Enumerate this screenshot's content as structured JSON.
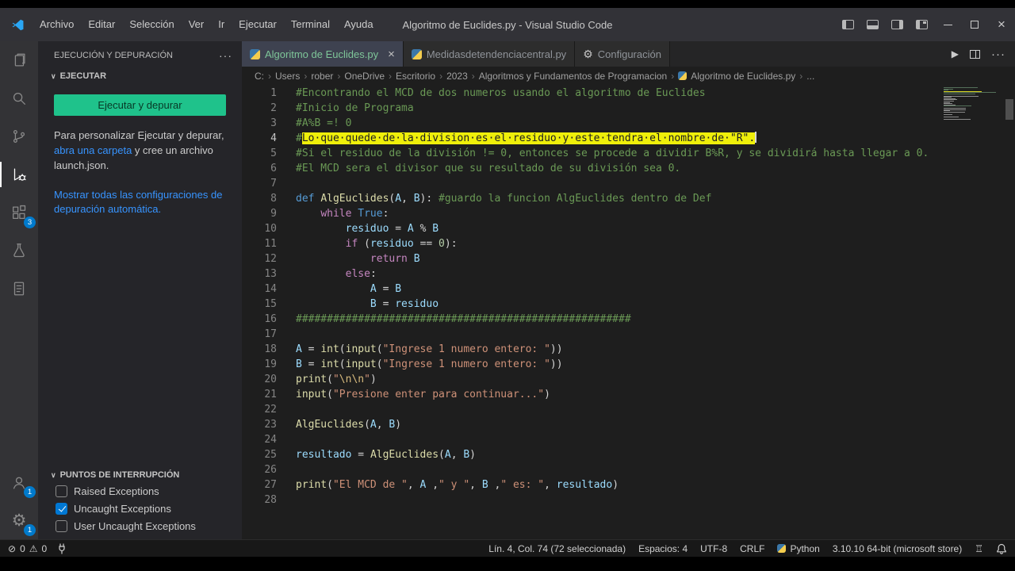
{
  "window": {
    "title": "Algoritmo de Euclides.py - Visual Studio Code"
  },
  "menu": [
    "Archivo",
    "Editar",
    "Selección",
    "Ver",
    "Ir",
    "Ejecutar",
    "Terminal",
    "Ayuda"
  ],
  "colors": {
    "link_accent": "#3794ff",
    "run_button_green": "#1fc28b",
    "selection_highlight": "#efef0a",
    "active_tab_label_green": "#7ec699",
    "badge_blue": "#007acc"
  },
  "tabs": [
    {
      "label": "Algoritmo de Euclides.py",
      "icon": "python",
      "active": true
    },
    {
      "label": "Medidasdetendenciacentral.py",
      "icon": "python",
      "active": false
    },
    {
      "label": "Configuración",
      "icon": "gear",
      "active": false
    }
  ],
  "editor_actions": {
    "run": "▶",
    "more": "···"
  },
  "breadcrumbs": {
    "items": [
      "C:",
      "Users",
      "rober",
      "OneDrive",
      "Escritorio",
      "2023",
      "Algoritmos y Fundamentos de Programacion"
    ],
    "file": "Algoritmo de Euclides.py",
    "more": "..."
  },
  "sidebar": {
    "title": "EJECUCIÓN Y DEPURACIÓN",
    "more": "···",
    "run_section": "EJECUTAR",
    "run_button": "Ejecutar y depurar",
    "hint_before": "Para personalizar Ejecutar y depurar, ",
    "hint_link": "abra una carpeta",
    "hint_after": " y cree un archivo launch.json.",
    "auto_link": "Mostrar todas las configuraciones de depuración automática.",
    "breakpoints_title": "PUNTOS DE INTERRUPCIÓN",
    "breakpoints": [
      {
        "label": "Raised Exceptions",
        "checked": false
      },
      {
        "label": "Uncaught Exceptions",
        "checked": true
      },
      {
        "label": "User Uncaught Exceptions",
        "checked": false
      }
    ]
  },
  "activity_badges": {
    "extensions": "3",
    "account": "1",
    "settings": "1"
  },
  "editor": {
    "active_line": 4,
    "lines": [
      {
        "n": 1,
        "segs": [
          [
            "c",
            "#Encontrando el MCD de dos numeros usando el algoritmo de Euclides"
          ]
        ]
      },
      {
        "n": 2,
        "segs": [
          [
            "c",
            "#Inicio de Programa"
          ]
        ]
      },
      {
        "n": 3,
        "segs": [
          [
            "c",
            "#A%B =! 0"
          ]
        ]
      },
      {
        "n": 4,
        "segs": [
          [
            "c",
            "#"
          ],
          [
            "sel",
            "Lo·que·quede·de·la·division·es·el·residuo·y·este·tendra·el·nombre·de·\"R\"."
          ]
        ]
      },
      {
        "n": 5,
        "segs": [
          [
            "c",
            "#Si el residuo de la división != 0, entonces se procede a dividir B%R, y se dividirá hasta llegar a 0."
          ]
        ]
      },
      {
        "n": 6,
        "segs": [
          [
            "c",
            "#El MCD sera el divisor que su resultado de su división sea 0."
          ]
        ]
      },
      {
        "n": 7,
        "segs": []
      },
      {
        "n": 8,
        "segs": [
          [
            "k",
            "def "
          ],
          [
            "f",
            "AlgEuclides"
          ],
          [
            "t",
            "("
          ],
          [
            "v",
            "A"
          ],
          [
            "t",
            ", "
          ],
          [
            "v",
            "B"
          ],
          [
            "t",
            "): "
          ],
          [
            "c",
            "#guardo la funcion AlgEuclides dentro de Def"
          ]
        ]
      },
      {
        "n": 9,
        "segs": [
          [
            "t",
            "    "
          ],
          [
            "p",
            "while"
          ],
          [
            "t",
            " "
          ],
          [
            "k",
            "True"
          ],
          [
            "t",
            ":"
          ]
        ]
      },
      {
        "n": 10,
        "segs": [
          [
            "t",
            "        "
          ],
          [
            "v",
            "residuo"
          ],
          [
            "t",
            " "
          ],
          [
            "o",
            "="
          ],
          [
            "t",
            " "
          ],
          [
            "v",
            "A"
          ],
          [
            "t",
            " "
          ],
          [
            "o",
            "%"
          ],
          [
            "t",
            " "
          ],
          [
            "v",
            "B"
          ]
        ]
      },
      {
        "n": 11,
        "segs": [
          [
            "t",
            "        "
          ],
          [
            "p",
            "if"
          ],
          [
            "t",
            " ("
          ],
          [
            "v",
            "residuo"
          ],
          [
            "t",
            " "
          ],
          [
            "o",
            "=="
          ],
          [
            "t",
            " "
          ],
          [
            "n",
            "0"
          ],
          [
            "t",
            "):"
          ]
        ]
      },
      {
        "n": 12,
        "segs": [
          [
            "t",
            "            "
          ],
          [
            "p",
            "return"
          ],
          [
            "t",
            " "
          ],
          [
            "v",
            "B"
          ]
        ]
      },
      {
        "n": 13,
        "segs": [
          [
            "t",
            "        "
          ],
          [
            "p",
            "else"
          ],
          [
            "t",
            ":"
          ]
        ]
      },
      {
        "n": 14,
        "segs": [
          [
            "t",
            "            "
          ],
          [
            "v",
            "A"
          ],
          [
            "t",
            " "
          ],
          [
            "o",
            "="
          ],
          [
            "t",
            " "
          ],
          [
            "v",
            "B"
          ]
        ]
      },
      {
        "n": 15,
        "segs": [
          [
            "t",
            "            "
          ],
          [
            "v",
            "B"
          ],
          [
            "t",
            " "
          ],
          [
            "o",
            "="
          ],
          [
            "t",
            " "
          ],
          [
            "v",
            "residuo"
          ]
        ]
      },
      {
        "n": 16,
        "segs": [
          [
            "c",
            "######################################################"
          ]
        ]
      },
      {
        "n": 17,
        "segs": []
      },
      {
        "n": 18,
        "segs": [
          [
            "v",
            "A"
          ],
          [
            "t",
            " "
          ],
          [
            "o",
            "="
          ],
          [
            "t",
            " "
          ],
          [
            "f",
            "int"
          ],
          [
            "t",
            "("
          ],
          [
            "f",
            "input"
          ],
          [
            "t",
            "("
          ],
          [
            "s",
            "\"Ingrese 1 numero entero: \""
          ],
          [
            "t",
            "))"
          ]
        ]
      },
      {
        "n": 19,
        "segs": [
          [
            "v",
            "B"
          ],
          [
            "t",
            " "
          ],
          [
            "o",
            "="
          ],
          [
            "t",
            " "
          ],
          [
            "f",
            "int"
          ],
          [
            "t",
            "("
          ],
          [
            "f",
            "input"
          ],
          [
            "t",
            "("
          ],
          [
            "s",
            "\"Ingrese 1 numero entero: \""
          ],
          [
            "t",
            "))"
          ]
        ]
      },
      {
        "n": 20,
        "segs": [
          [
            "f",
            "print"
          ],
          [
            "t",
            "("
          ],
          [
            "s",
            "\""
          ],
          [
            "e",
            "\\n\\n"
          ],
          [
            "s",
            "\""
          ],
          [
            "t",
            ")"
          ]
        ]
      },
      {
        "n": 21,
        "segs": [
          [
            "f",
            "input"
          ],
          [
            "t",
            "("
          ],
          [
            "s",
            "\"Presione enter para continuar...\""
          ],
          [
            "t",
            ")"
          ]
        ]
      },
      {
        "n": 22,
        "segs": []
      },
      {
        "n": 23,
        "segs": [
          [
            "f",
            "AlgEuclides"
          ],
          [
            "t",
            "("
          ],
          [
            "v",
            "A"
          ],
          [
            "t",
            ", "
          ],
          [
            "v",
            "B"
          ],
          [
            "t",
            ")"
          ]
        ]
      },
      {
        "n": 24,
        "segs": []
      },
      {
        "n": 25,
        "segs": [
          [
            "v",
            "resultado"
          ],
          [
            "t",
            " "
          ],
          [
            "o",
            "="
          ],
          [
            "t",
            " "
          ],
          [
            "f",
            "AlgEuclides"
          ],
          [
            "t",
            "("
          ],
          [
            "v",
            "A"
          ],
          [
            "t",
            ", "
          ],
          [
            "v",
            "B"
          ],
          [
            "t",
            ")"
          ]
        ]
      },
      {
        "n": 26,
        "segs": []
      },
      {
        "n": 27,
        "segs": [
          [
            "f",
            "print"
          ],
          [
            "t",
            "("
          ],
          [
            "s",
            "\"El MCD de \""
          ],
          [
            "t",
            ", "
          ],
          [
            "v",
            "A"
          ],
          [
            "t",
            " ,"
          ],
          [
            "s",
            "\" y \""
          ],
          [
            "t",
            ", "
          ],
          [
            "v",
            "B"
          ],
          [
            "t",
            " ,"
          ],
          [
            "s",
            "\" es: \""
          ],
          [
            "t",
            ", "
          ],
          [
            "v",
            "resultado"
          ],
          [
            "t",
            ")"
          ]
        ]
      },
      {
        "n": 28,
        "segs": []
      }
    ]
  },
  "status_bar": {
    "errors": "0",
    "warnings": "0",
    "cursor": "Lín. 4, Col. 74 (72 seleccionada)",
    "indent": "Espacios: 4",
    "encoding": "UTF-8",
    "eol": "CRLF",
    "language": "Python",
    "interpreter": "3.10.10 64-bit (microsoft store)"
  }
}
